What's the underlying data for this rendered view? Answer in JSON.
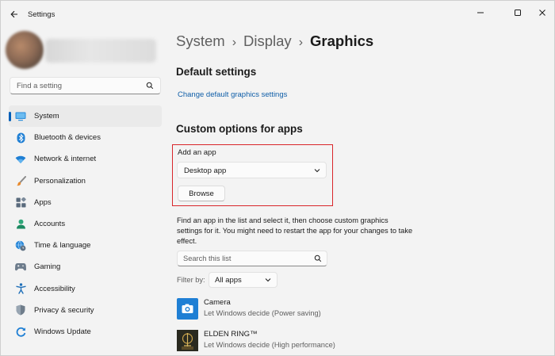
{
  "window": {
    "title": "Settings"
  },
  "sidebar": {
    "search_placeholder": "Find a setting",
    "items": [
      {
        "label": "System",
        "icon": "monitor-icon",
        "active": true
      },
      {
        "label": "Bluetooth & devices",
        "icon": "bluetooth-icon"
      },
      {
        "label": "Network & internet",
        "icon": "wifi-icon"
      },
      {
        "label": "Personalization",
        "icon": "brush-icon"
      },
      {
        "label": "Apps",
        "icon": "apps-icon"
      },
      {
        "label": "Accounts",
        "icon": "person-icon"
      },
      {
        "label": "Time & language",
        "icon": "globe-clock-icon"
      },
      {
        "label": "Gaming",
        "icon": "gamepad-icon"
      },
      {
        "label": "Accessibility",
        "icon": "accessibility-icon"
      },
      {
        "label": "Privacy & security",
        "icon": "shield-icon"
      },
      {
        "label": "Windows Update",
        "icon": "refresh-icon"
      }
    ]
  },
  "breadcrumb": {
    "part1": "System",
    "part2": "Display",
    "current": "Graphics"
  },
  "default_settings": {
    "heading": "Default settings",
    "link": "Change default graphics settings"
  },
  "custom_options": {
    "heading": "Custom options for apps",
    "add_app_label": "Add an app",
    "add_app_value": "Desktop app",
    "browse_label": "Browse",
    "description": "Find an app in the list and select it, then choose custom graphics settings for it. You might need to restart the app for your changes to take effect.",
    "search_placeholder": "Search this list",
    "filter_label": "Filter by:",
    "filter_value": "All apps"
  },
  "apps": [
    {
      "name": "Camera",
      "setting": "Let Windows decide (Power saving)"
    },
    {
      "name": "ELDEN RING™",
      "setting": "Let Windows decide (High performance)"
    }
  ],
  "colors": {
    "accent": "#005fb8",
    "highlight_box": "#d9252a",
    "link": "#0f5ea8"
  }
}
